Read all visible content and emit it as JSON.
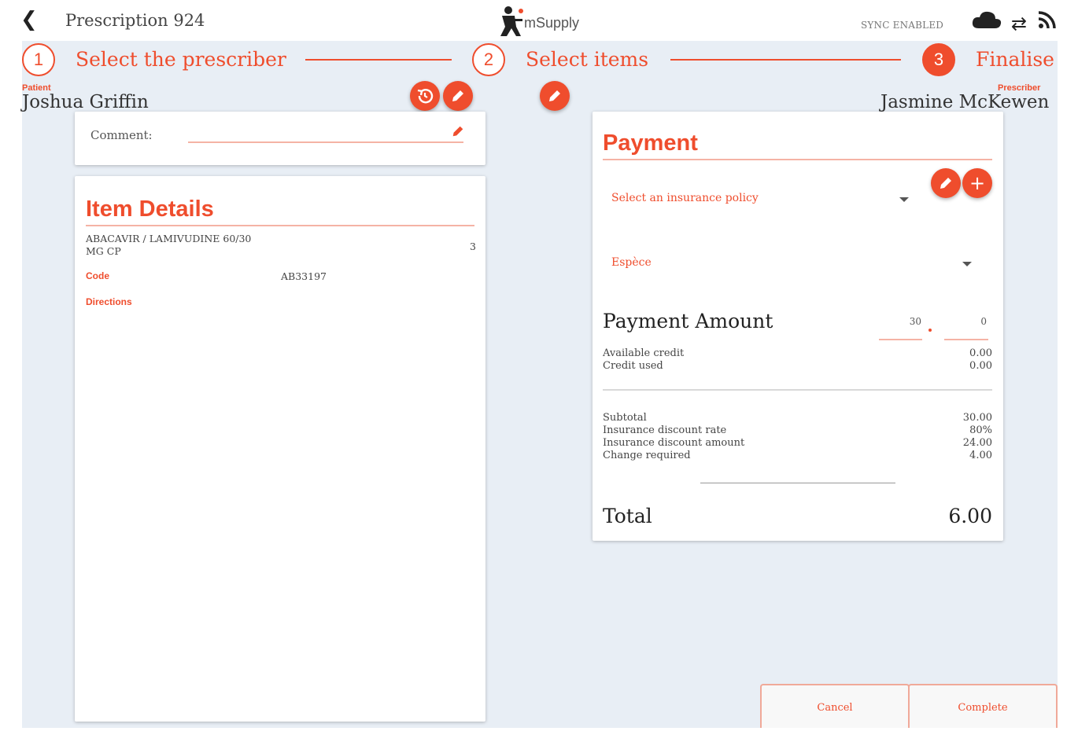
{
  "header": {
    "back_icon": "chevron-left-icon",
    "title": "Prescription 924",
    "logo_text": "mSupply",
    "sync_status": "SYNC ENABLED",
    "icons": [
      "cloud-icon",
      "sync-arrows-icon",
      "rss-icon"
    ]
  },
  "steps": [
    {
      "number": "1",
      "label": "Select the prescriber",
      "state": "done"
    },
    {
      "number": "2",
      "label": "Select items",
      "state": "done"
    },
    {
      "number": "3",
      "label": "Finalise",
      "state": "active"
    }
  ],
  "patient": {
    "label": "Patient",
    "name": "Joshua Griffin"
  },
  "prescriber": {
    "label": "Prescriber",
    "name": "Jasmine McKewen"
  },
  "comment": {
    "label": "Comment:",
    "value": ""
  },
  "item_details": {
    "title": "Item Details",
    "item_name": "ABACAVIR / LAMIVUDINE 60/30",
    "item_name_cont": "MG CP",
    "quantity": "3",
    "code_label": "Code",
    "code_value": "AB33197",
    "directions_label": "Directions",
    "directions_value": ""
  },
  "payment": {
    "title": "Payment",
    "insurance_placeholder": "Select an insurance policy",
    "payment_type": "Espèce",
    "amount_label": "Payment Amount",
    "amount_whole": "30",
    "amount_fraction": "0",
    "available_credit_label": "Available credit",
    "available_credit_value": "0.00",
    "credit_used_label": "Credit used",
    "credit_used_value": "0.00",
    "subtotal_label": "Subtotal",
    "subtotal_value": "30.00",
    "discount_rate_label": "Insurance discount rate",
    "discount_rate_value": "80%",
    "discount_amount_label": "Insurance discount amount",
    "discount_amount_value": "24.00",
    "change_label": "Change required",
    "change_value": "4.00",
    "total_label": "Total",
    "total_value": "6.00"
  },
  "actions": {
    "cancel": "Cancel",
    "complete": "Complete"
  },
  "colors": {
    "accent": "#ef4d2d",
    "background": "#e8eef5"
  }
}
